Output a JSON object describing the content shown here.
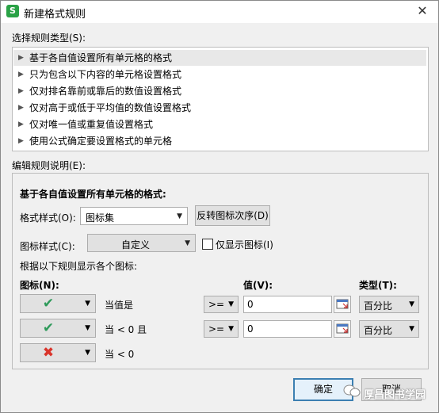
{
  "window": {
    "title": "新建格式规则",
    "app_icon": "S",
    "close_icon": "close-icon"
  },
  "rule_type_section": {
    "label": "选择规则类型(S):",
    "items": [
      "基于各自值设置所有单元格的格式",
      "只为包含以下内容的单元格设置格式",
      "仅对排名靠前或靠后的数值设置格式",
      "仅对高于或低于平均值的数值设置格式",
      "仅对唯一值或重复值设置格式",
      "使用公式确定要设置格式的单元格"
    ],
    "selected_index": 0
  },
  "edit_section": {
    "label": "编辑规则说明(E):",
    "heading": "基于各自值设置所有单元格的格式:",
    "format_style_label": "格式样式(O):",
    "format_style_value": "图标集",
    "reverse_button": "反转图标次序(D)",
    "icon_style_label": "图标样式(C):",
    "icon_style_value": "自定义",
    "show_icon_only_label": "仅显示图标(I)",
    "show_icon_only_checked": false,
    "rules_caption": "根据以下规则显示各个图标:",
    "col_icon": "图标(N):",
    "col_value": "值(V):",
    "col_type": "类型(T):",
    "rows": [
      {
        "icon": "checkmark-icon",
        "glyph": "✔",
        "color": "#2e9a5a",
        "condition": "当值是",
        "operator": ">=",
        "value": "0",
        "type": "百分比"
      },
      {
        "icon": "checkmark-icon",
        "glyph": "✔",
        "color": "#2e9a5a",
        "condition": "当 < 0 且",
        "operator": ">=",
        "value": "0",
        "type": "百分比"
      },
      {
        "icon": "cross-icon",
        "glyph": "✖",
        "color": "#d9342b",
        "condition": "当 < 0"
      }
    ]
  },
  "footer": {
    "ok": "确定",
    "cancel": "取消",
    "watermark": "厚昌图书学园"
  }
}
